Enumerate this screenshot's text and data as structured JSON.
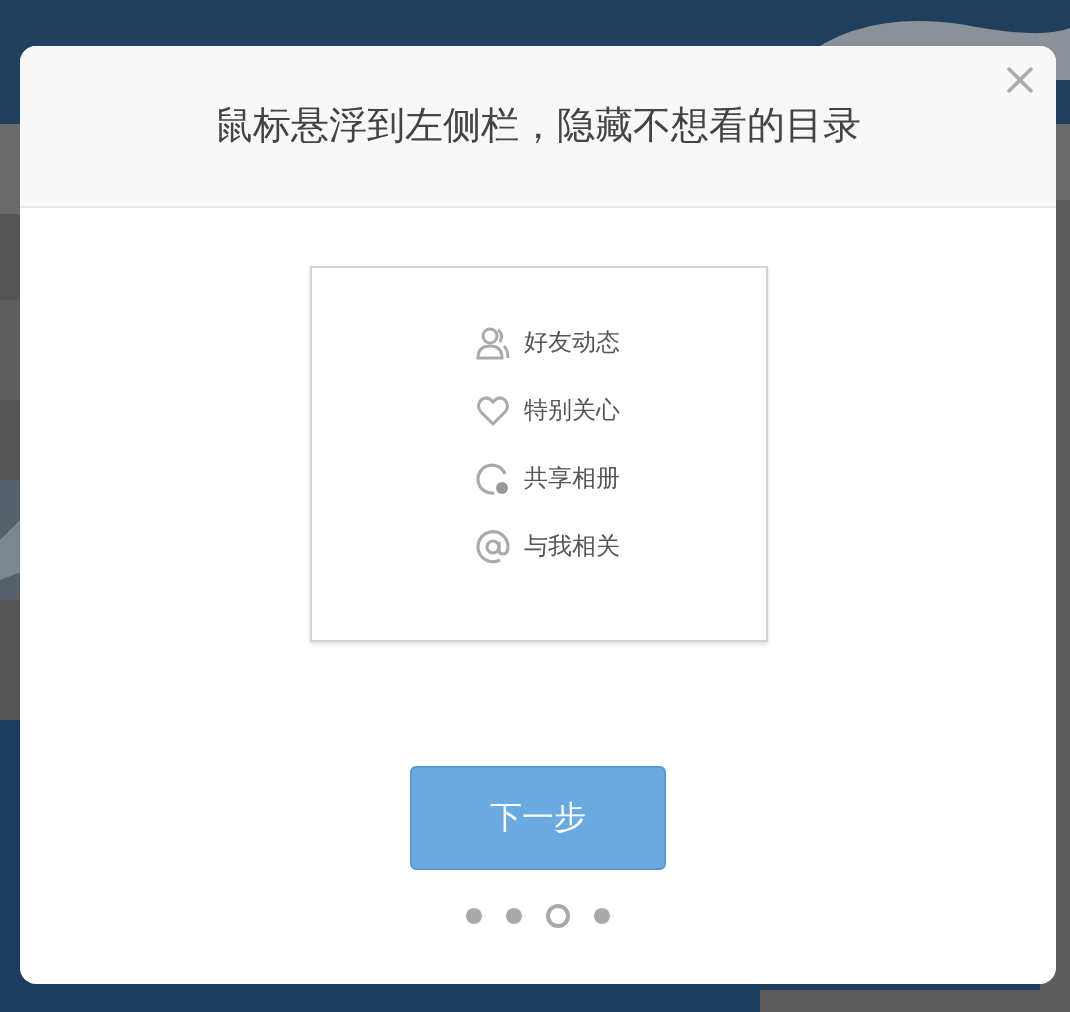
{
  "dialog": {
    "title": "鼠标悬浮到左侧栏，隐藏不想看的目录",
    "preview": {
      "items": [
        {
          "kind": "friends",
          "label": "好友动态"
        },
        {
          "kind": "heart",
          "label": "特别关心"
        },
        {
          "kind": "album",
          "label": "共享相册"
        },
        {
          "kind": "at",
          "label": "与我相关"
        }
      ]
    },
    "next_button": "下一步",
    "steps": [
      {
        "selected": false
      },
      {
        "selected": false
      },
      {
        "selected": true
      },
      {
        "selected": false
      }
    ]
  }
}
